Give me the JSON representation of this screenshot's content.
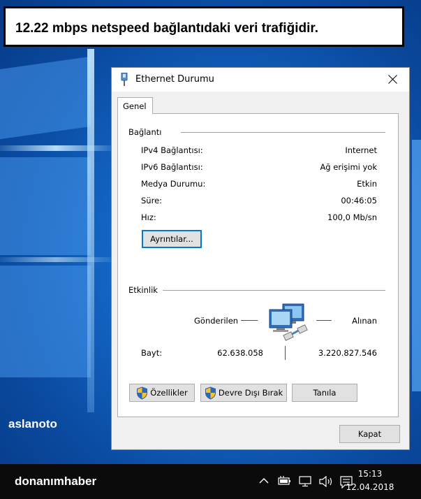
{
  "banner": {
    "text": "12.22 mbps netspeed bağlantıdaki veri trafiğidir."
  },
  "desktop": {
    "username": "aslanoto"
  },
  "dialog": {
    "title": "Ethernet Durumu",
    "tab": "Genel",
    "connection": {
      "heading": "Bağlantı",
      "rows": [
        {
          "label": "IPv4 Bağlantısı:",
          "value": "Internet"
        },
        {
          "label": "IPv6 Bağlantısı:",
          "value": "Ağ erişimi yok"
        },
        {
          "label": "Medya Durumu:",
          "value": "Etkin"
        },
        {
          "label": "Süre:",
          "value": "00:46:05"
        },
        {
          "label": "Hız:",
          "value": "100,0 Mb/sn"
        }
      ],
      "details_button": "Ayrıntılar..."
    },
    "activity": {
      "heading": "Etkinlik",
      "sent_label": "Gönderilen",
      "received_label": "Alınan",
      "bytes_label": "Bayt:",
      "bytes_sent": "62.638.058",
      "bytes_received": "3.220.827.546"
    },
    "buttons": {
      "properties": "Özellikler",
      "disable": "Devre Dışı Bırak",
      "diagnose": "Tanıla",
      "close": "Kapat"
    }
  },
  "taskbar": {
    "brand": "donanımhaber",
    "time": "15:13",
    "date": "12.04.2018"
  },
  "icons": [
    "ethernet-icon",
    "close-icon",
    "shield-icon",
    "network-computers-icon",
    "chevron-up-icon",
    "battery-icon",
    "network-icon",
    "volume-icon",
    "notification-icon"
  ]
}
